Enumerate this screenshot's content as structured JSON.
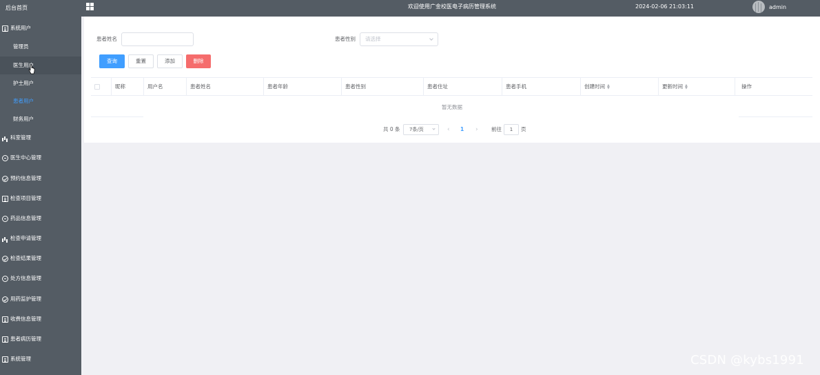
{
  "sidebar": {
    "brand": "后台首页",
    "group": "系统用户",
    "sub_items": [
      "管理员",
      "医生用户",
      "护士用户",
      "患者用户",
      "财务用户"
    ],
    "active_sub": "患者用户",
    "hover_sub": "医生用户",
    "menu_items": [
      {
        "label": "科室管理",
        "icon": "bar-chart-icon"
      },
      {
        "label": "医生中心管理",
        "icon": "chat-icon"
      },
      {
        "label": "预约信息管理",
        "icon": "check-circle-icon"
      },
      {
        "label": "检查项目管理",
        "icon": "document-icon"
      },
      {
        "label": "药品信息管理",
        "icon": "chat-icon"
      },
      {
        "label": "检查申请管理",
        "icon": "bar-chart-icon"
      },
      {
        "label": "检查结果管理",
        "icon": "check-circle-icon"
      },
      {
        "label": "处方信息管理",
        "icon": "chat-icon"
      },
      {
        "label": "用药监护管理",
        "icon": "check-circle-icon"
      },
      {
        "label": "收费信息管理",
        "icon": "document-icon"
      },
      {
        "label": "患者病历管理",
        "icon": "document-icon"
      },
      {
        "label": "系统管理",
        "icon": "document-icon"
      }
    ]
  },
  "header": {
    "title": "欢迎使用广金校医电子病历管理系统",
    "datetime": "2024-02-06 21:03:11",
    "user": "admin"
  },
  "search": {
    "name_label": "患者姓名",
    "name_value": "",
    "gender_label": "患者性别",
    "gender_placeholder": "请选择"
  },
  "buttons": {
    "query": "查询",
    "reset": "重置",
    "add": "添加",
    "delete": "删除"
  },
  "table": {
    "columns": [
      "昵称",
      "用户名",
      "患者姓名",
      "患者年龄",
      "患者性别",
      "患者住址",
      "患者手机",
      "创建时间",
      "更新时间",
      "操作"
    ],
    "empty_text": "暂无数据"
  },
  "pagination": {
    "total_text": "共 0 条",
    "page_size": "7条/页",
    "current_page": "1",
    "goto_label": "前往",
    "goto_value": "1",
    "page_unit": "页"
  },
  "watermark": "CSDN @kybs1991",
  "colors": {
    "sidebar_bg": "#545c64",
    "accent": "#409eff",
    "danger": "#f56c6c"
  }
}
